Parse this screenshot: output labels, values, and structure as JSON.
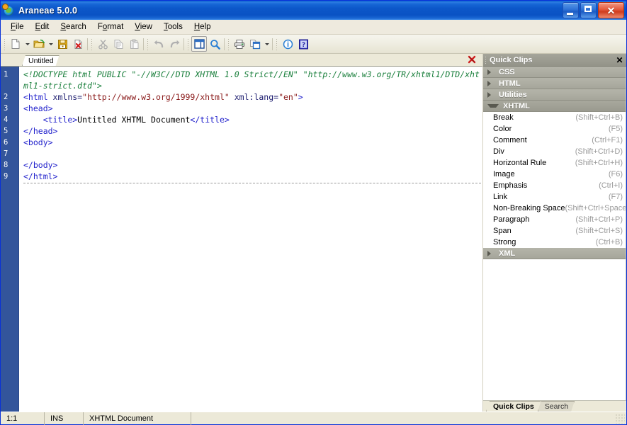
{
  "window": {
    "title": "Araneae 5.0.0",
    "icon": "araneae-globe-icon",
    "minimize_label": "Minimize",
    "maximize_label": "Maximize",
    "close_label": "Close"
  },
  "menubar": {
    "items": [
      {
        "label": "File",
        "accel": "F"
      },
      {
        "label": "Edit",
        "accel": "E"
      },
      {
        "label": "Search",
        "accel": "S"
      },
      {
        "label": "Format",
        "accel": "o"
      },
      {
        "label": "View",
        "accel": "V"
      },
      {
        "label": "Tools",
        "accel": "T"
      },
      {
        "label": "Help",
        "accel": "H"
      }
    ]
  },
  "toolbar": {
    "buttons": [
      {
        "name": "new-document-button",
        "icon": "new-page-icon",
        "dropdown": true
      },
      {
        "name": "open-file-button",
        "icon": "open-folder-icon",
        "dropdown": true
      },
      {
        "name": "save-button",
        "icon": "floppy-disk-icon",
        "dropdown": false
      },
      {
        "name": "close-document-button",
        "icon": "page-delete-icon",
        "dropdown": false
      },
      {
        "name": "cut-button",
        "icon": "scissors-icon",
        "dropdown": false
      },
      {
        "name": "copy-button",
        "icon": "copy-pages-icon",
        "dropdown": false
      },
      {
        "name": "paste-button",
        "icon": "clipboard-icon",
        "dropdown": false
      },
      {
        "name": "undo-button",
        "icon": "undo-arrow-icon",
        "dropdown": false
      },
      {
        "name": "redo-button",
        "icon": "redo-arrow-icon",
        "dropdown": false
      },
      {
        "name": "toggle-panel-button",
        "icon": "side-panel-icon",
        "dropdown": false,
        "pressed": true
      },
      {
        "name": "find-button",
        "icon": "magnifier-icon",
        "dropdown": false
      },
      {
        "name": "print-button",
        "icon": "printer-icon",
        "dropdown": false
      },
      {
        "name": "preview-button",
        "icon": "browser-preview-icon",
        "dropdown": true
      },
      {
        "name": "about-button",
        "icon": "info-circle-icon",
        "dropdown": false
      },
      {
        "name": "help-button",
        "icon": "question-book-icon",
        "dropdown": false
      }
    ]
  },
  "editor": {
    "tab_label": "Untitled",
    "tab_close_icon": "red-x-close-icon",
    "line_numbers": [
      "1",
      "2",
      "3",
      "4",
      "5",
      "6",
      "7",
      "8",
      "9"
    ],
    "lines": [
      {
        "n": "1",
        "tokens": [
          {
            "t": "doctype",
            "s": "<!DOCTYPE html PUBLIC \"-//W3C//DTD XHTML 1.0 Strict//EN\" \"http://www.w3.org/TR/xhtml1/DTD/xhtml1-strict.dtd\">"
          }
        ]
      },
      {
        "n": "2",
        "tokens": [
          {
            "t": "tag",
            "s": "<html "
          },
          {
            "t": "attr",
            "s": "xmlns="
          },
          {
            "t": "val",
            "s": "\"http://www.w3.org/1999/xhtml\""
          },
          {
            "t": "tag",
            "s": " "
          },
          {
            "t": "attr",
            "s": "xml:lang="
          },
          {
            "t": "val",
            "s": "\"en\""
          },
          {
            "t": "tag",
            "s": ">"
          }
        ]
      },
      {
        "n": "3",
        "tokens": [
          {
            "t": "tag",
            "s": "<head>"
          }
        ]
      },
      {
        "n": "4",
        "tokens": [
          {
            "t": "text",
            "s": "    "
          },
          {
            "t": "tag",
            "s": "<title>"
          },
          {
            "t": "text",
            "s": "Untitled XHTML Document"
          },
          {
            "t": "tag",
            "s": "</title>"
          }
        ]
      },
      {
        "n": "5",
        "tokens": [
          {
            "t": "tag",
            "s": "</head>"
          }
        ]
      },
      {
        "n": "6",
        "tokens": [
          {
            "t": "tag",
            "s": "<body>"
          }
        ]
      },
      {
        "n": "7",
        "tokens": [
          {
            "t": "text",
            "s": ""
          }
        ]
      },
      {
        "n": "8",
        "tokens": [
          {
            "t": "tag",
            "s": "</body>"
          }
        ]
      },
      {
        "n": "9",
        "tokens": [
          {
            "t": "tag",
            "s": "</html>"
          }
        ]
      }
    ]
  },
  "panel": {
    "title": "Quick Clips",
    "close_icon": "panel-close-icon",
    "groups": [
      {
        "label": "CSS",
        "expanded": false,
        "items": []
      },
      {
        "label": "HTML",
        "expanded": false,
        "items": []
      },
      {
        "label": "Utilities",
        "expanded": false,
        "items": []
      },
      {
        "label": "XHTML",
        "expanded": true,
        "items": [
          {
            "label": "Break",
            "shortcut": "(Shift+Ctrl+B)"
          },
          {
            "label": "Color",
            "shortcut": "(F5)"
          },
          {
            "label": "Comment",
            "shortcut": "(Ctrl+F1)"
          },
          {
            "label": "Div",
            "shortcut": "(Shift+Ctrl+D)"
          },
          {
            "label": "Horizontal Rule",
            "shortcut": "(Shift+Ctrl+H)"
          },
          {
            "label": "Image",
            "shortcut": "(F6)"
          },
          {
            "label": "Emphasis",
            "shortcut": "(Ctrl+I)"
          },
          {
            "label": "Link",
            "shortcut": "(F7)"
          },
          {
            "label": "Non-Breaking Space",
            "shortcut": "(Shift+Ctrl+Space)"
          },
          {
            "label": "Paragraph",
            "shortcut": "(Shift+Ctrl+P)"
          },
          {
            "label": "Span",
            "shortcut": "(Shift+Ctrl+S)"
          },
          {
            "label": "Strong",
            "shortcut": "(Ctrl+B)"
          }
        ]
      },
      {
        "label": "XML",
        "expanded": false,
        "items": []
      }
    ],
    "tabs": [
      {
        "label": "Quick Clips",
        "active": true
      },
      {
        "label": "Search",
        "active": false
      }
    ]
  },
  "statusbar": {
    "cursor_position": "1:1",
    "insert_mode": "INS",
    "document_type": "XHTML Document",
    "extra": ""
  }
}
